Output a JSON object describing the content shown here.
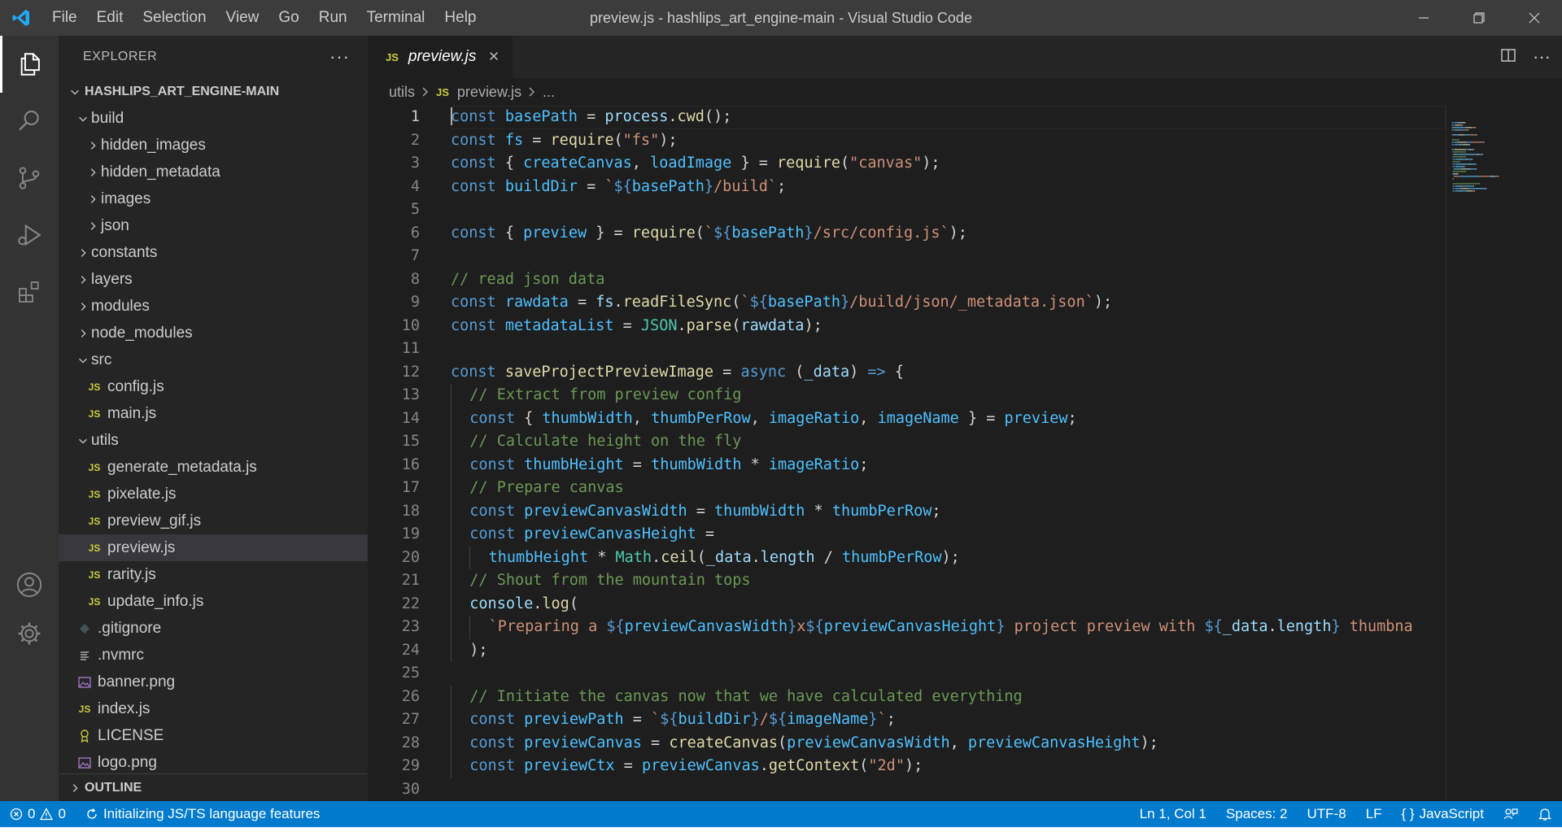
{
  "window": {
    "title": "preview.js - hashlips_art_engine-main - Visual Studio Code",
    "menu": [
      "File",
      "Edit",
      "Selection",
      "View",
      "Go",
      "Run",
      "Terminal",
      "Help"
    ]
  },
  "sidebar": {
    "header": "EXPLORER",
    "root": "HASHLIPS_ART_ENGINE-MAIN",
    "outline": "OUTLINE",
    "tree": [
      {
        "label": "build",
        "type": "folder",
        "open": true,
        "depth": 1
      },
      {
        "label": "hidden_images",
        "type": "folder",
        "open": false,
        "depth": 2
      },
      {
        "label": "hidden_metadata",
        "type": "folder",
        "open": false,
        "depth": 2
      },
      {
        "label": "images",
        "type": "folder",
        "open": false,
        "depth": 2
      },
      {
        "label": "json",
        "type": "folder",
        "open": false,
        "depth": 2
      },
      {
        "label": "constants",
        "type": "folder",
        "open": false,
        "depth": 1
      },
      {
        "label": "layers",
        "type": "folder",
        "open": false,
        "depth": 1
      },
      {
        "label": "modules",
        "type": "folder",
        "open": false,
        "depth": 1
      },
      {
        "label": "node_modules",
        "type": "folder",
        "open": false,
        "depth": 1
      },
      {
        "label": "src",
        "type": "folder",
        "open": true,
        "depth": 1
      },
      {
        "label": "config.js",
        "type": "js",
        "depth": 2
      },
      {
        "label": "main.js",
        "type": "js",
        "depth": 2
      },
      {
        "label": "utils",
        "type": "folder",
        "open": true,
        "depth": 1
      },
      {
        "label": "generate_metadata.js",
        "type": "js",
        "depth": 2
      },
      {
        "label": "pixelate.js",
        "type": "js",
        "depth": 2
      },
      {
        "label": "preview_gif.js",
        "type": "js",
        "depth": 2
      },
      {
        "label": "preview.js",
        "type": "js",
        "depth": 2,
        "selected": true
      },
      {
        "label": "rarity.js",
        "type": "js",
        "depth": 2
      },
      {
        "label": "update_info.js",
        "type": "js",
        "depth": 2
      },
      {
        "label": ".gitignore",
        "type": "git",
        "depth": 1
      },
      {
        "label": ".nvmrc",
        "type": "text",
        "depth": 1
      },
      {
        "label": "banner.png",
        "type": "image",
        "depth": 1
      },
      {
        "label": "index.js",
        "type": "js",
        "depth": 1
      },
      {
        "label": "LICENSE",
        "type": "license",
        "depth": 1
      },
      {
        "label": "logo.png",
        "type": "image",
        "depth": 1
      }
    ]
  },
  "editor": {
    "tab_label": "preview.js",
    "js_badge": "JS",
    "breadcrumb": [
      "utils",
      "preview.js",
      "..."
    ],
    "lines": [
      [
        [
          "kw",
          "const"
        ],
        [
          "p",
          " "
        ],
        [
          "cvar",
          "basePath"
        ],
        [
          "p",
          " = "
        ],
        [
          "var",
          "process"
        ],
        [
          "p",
          "."
        ],
        [
          "fn",
          "cwd"
        ],
        [
          "p",
          "();"
        ]
      ],
      [
        [
          "kw",
          "const"
        ],
        [
          "p",
          " "
        ],
        [
          "cvar",
          "fs"
        ],
        [
          "p",
          " = "
        ],
        [
          "fn",
          "require"
        ],
        [
          "p",
          "("
        ],
        [
          "str",
          "\"fs\""
        ],
        [
          "p",
          ");"
        ]
      ],
      [
        [
          "kw",
          "const"
        ],
        [
          "p",
          " { "
        ],
        [
          "cvar",
          "createCanvas"
        ],
        [
          "p",
          ", "
        ],
        [
          "cvar",
          "loadImage"
        ],
        [
          "p",
          " } = "
        ],
        [
          "fn",
          "require"
        ],
        [
          "p",
          "("
        ],
        [
          "str",
          "\"canvas\""
        ],
        [
          "p",
          ");"
        ]
      ],
      [
        [
          "kw",
          "const"
        ],
        [
          "p",
          " "
        ],
        [
          "cvar",
          "buildDir"
        ],
        [
          "p",
          " = "
        ],
        [
          "str",
          "`"
        ],
        [
          "tmpl",
          "${"
        ],
        [
          "cvar",
          "basePath"
        ],
        [
          "tmpl",
          "}"
        ],
        [
          "str",
          "/build`"
        ],
        [
          "p",
          ";"
        ]
      ],
      [],
      [
        [
          "kw",
          "const"
        ],
        [
          "p",
          " { "
        ],
        [
          "cvar",
          "preview"
        ],
        [
          "p",
          " } = "
        ],
        [
          "fn",
          "require"
        ],
        [
          "p",
          "("
        ],
        [
          "str",
          "`"
        ],
        [
          "tmpl",
          "${"
        ],
        [
          "cvar",
          "basePath"
        ],
        [
          "tmpl",
          "}"
        ],
        [
          "str",
          "/src/config.js`"
        ],
        [
          "p",
          ");"
        ]
      ],
      [],
      [
        [
          "cm",
          "// read json data"
        ]
      ],
      [
        [
          "kw",
          "const"
        ],
        [
          "p",
          " "
        ],
        [
          "cvar",
          "rawdata"
        ],
        [
          "p",
          " = "
        ],
        [
          "var",
          "fs"
        ],
        [
          "p",
          "."
        ],
        [
          "fn",
          "readFileSync"
        ],
        [
          "p",
          "("
        ],
        [
          "str",
          "`"
        ],
        [
          "tmpl",
          "${"
        ],
        [
          "cvar",
          "basePath"
        ],
        [
          "tmpl",
          "}"
        ],
        [
          "str",
          "/build/json/_metadata.json`"
        ],
        [
          "p",
          ");"
        ]
      ],
      [
        [
          "kw",
          "const"
        ],
        [
          "p",
          " "
        ],
        [
          "cvar",
          "metadataList"
        ],
        [
          "p",
          " = "
        ],
        [
          "ty",
          "JSON"
        ],
        [
          "p",
          "."
        ],
        [
          "fn",
          "parse"
        ],
        [
          "p",
          "("
        ],
        [
          "var",
          "rawdata"
        ],
        [
          "p",
          ");"
        ]
      ],
      [],
      [
        [
          "kw",
          "const"
        ],
        [
          "p",
          " "
        ],
        [
          "fn",
          "saveProjectPreviewImage"
        ],
        [
          "p",
          " = "
        ],
        [
          "kw",
          "async"
        ],
        [
          "p",
          " ("
        ],
        [
          "var",
          "_data"
        ],
        [
          "p",
          ") "
        ],
        [
          "kw",
          "=>"
        ],
        [
          "p",
          " {"
        ]
      ],
      [
        [
          "g",
          ""
        ],
        [
          "cm",
          "// Extract from preview config"
        ]
      ],
      [
        [
          "g",
          ""
        ],
        [
          "kw",
          "const"
        ],
        [
          "p",
          " { "
        ],
        [
          "cvar",
          "thumbWidth"
        ],
        [
          "p",
          ", "
        ],
        [
          "cvar",
          "thumbPerRow"
        ],
        [
          "p",
          ", "
        ],
        [
          "cvar",
          "imageRatio"
        ],
        [
          "p",
          ", "
        ],
        [
          "cvar",
          "imageName"
        ],
        [
          "p",
          " } = "
        ],
        [
          "cvar",
          "preview"
        ],
        [
          "p",
          ";"
        ]
      ],
      [
        [
          "g",
          ""
        ],
        [
          "cm",
          "// Calculate height on the fly"
        ]
      ],
      [
        [
          "g",
          ""
        ],
        [
          "kw",
          "const"
        ],
        [
          "p",
          " "
        ],
        [
          "cvar",
          "thumbHeight"
        ],
        [
          "p",
          " = "
        ],
        [
          "cvar",
          "thumbWidth"
        ],
        [
          "p",
          " * "
        ],
        [
          "cvar",
          "imageRatio"
        ],
        [
          "p",
          ";"
        ]
      ],
      [
        [
          "g",
          ""
        ],
        [
          "cm",
          "// Prepare canvas"
        ]
      ],
      [
        [
          "g",
          ""
        ],
        [
          "kw",
          "const"
        ],
        [
          "p",
          " "
        ],
        [
          "cvar",
          "previewCanvasWidth"
        ],
        [
          "p",
          " = "
        ],
        [
          "cvar",
          "thumbWidth"
        ],
        [
          "p",
          " * "
        ],
        [
          "cvar",
          "thumbPerRow"
        ],
        [
          "p",
          ";"
        ]
      ],
      [
        [
          "g",
          ""
        ],
        [
          "kw",
          "const"
        ],
        [
          "p",
          " "
        ],
        [
          "cvar",
          "previewCanvasHeight"
        ],
        [
          "p",
          " ="
        ]
      ],
      [
        [
          "g",
          ""
        ],
        [
          "g",
          ""
        ],
        [
          "cvar",
          "thumbHeight"
        ],
        [
          "p",
          " * "
        ],
        [
          "ty",
          "Math"
        ],
        [
          "p",
          "."
        ],
        [
          "fn",
          "ceil"
        ],
        [
          "p",
          "("
        ],
        [
          "var",
          "_data"
        ],
        [
          "p",
          "."
        ],
        [
          "var",
          "length"
        ],
        [
          "p",
          " / "
        ],
        [
          "cvar",
          "thumbPerRow"
        ],
        [
          "p",
          ");"
        ]
      ],
      [
        [
          "g",
          ""
        ],
        [
          "cm",
          "// Shout from the mountain tops"
        ]
      ],
      [
        [
          "g",
          ""
        ],
        [
          "var",
          "console"
        ],
        [
          "p",
          "."
        ],
        [
          "fn",
          "log"
        ],
        [
          "p",
          "("
        ]
      ],
      [
        [
          "g",
          ""
        ],
        [
          "g",
          ""
        ],
        [
          "str",
          "`Preparing a "
        ],
        [
          "tmpl",
          "${"
        ],
        [
          "cvar",
          "previewCanvasWidth"
        ],
        [
          "tmpl",
          "}"
        ],
        [
          "str",
          "x"
        ],
        [
          "tmpl",
          "${"
        ],
        [
          "cvar",
          "previewCanvasHeight"
        ],
        [
          "tmpl",
          "}"
        ],
        [
          "str",
          " project preview with "
        ],
        [
          "tmpl",
          "${"
        ],
        [
          "var",
          "_data"
        ],
        [
          "p",
          "."
        ],
        [
          "var",
          "length"
        ],
        [
          "tmpl",
          "}"
        ],
        [
          "str",
          " thumbna"
        ]
      ],
      [
        [
          "g",
          ""
        ],
        [
          "p",
          ");"
        ]
      ],
      [],
      [
        [
          "g",
          ""
        ],
        [
          "cm",
          "// Initiate the canvas now that we have calculated everything"
        ]
      ],
      [
        [
          "g",
          ""
        ],
        [
          "kw",
          "const"
        ],
        [
          "p",
          " "
        ],
        [
          "cvar",
          "previewPath"
        ],
        [
          "p",
          " = "
        ],
        [
          "str",
          "`"
        ],
        [
          "tmpl",
          "${"
        ],
        [
          "cvar",
          "buildDir"
        ],
        [
          "tmpl",
          "}"
        ],
        [
          "str",
          "/"
        ],
        [
          "tmpl",
          "${"
        ],
        [
          "cvar",
          "imageName"
        ],
        [
          "tmpl",
          "}"
        ],
        [
          "str",
          "`"
        ],
        [
          "p",
          ";"
        ]
      ],
      [
        [
          "g",
          ""
        ],
        [
          "kw",
          "const"
        ],
        [
          "p",
          " "
        ],
        [
          "cvar",
          "previewCanvas"
        ],
        [
          "p",
          " = "
        ],
        [
          "fn",
          "createCanvas"
        ],
        [
          "p",
          "("
        ],
        [
          "cvar",
          "previewCanvasWidth"
        ],
        [
          "p",
          ", "
        ],
        [
          "cvar",
          "previewCanvasHeight"
        ],
        [
          "p",
          ");"
        ]
      ],
      [
        [
          "g",
          ""
        ],
        [
          "kw",
          "const"
        ],
        [
          "p",
          " "
        ],
        [
          "cvar",
          "previewCtx"
        ],
        [
          "p",
          " = "
        ],
        [
          "cvar",
          "previewCanvas"
        ],
        [
          "p",
          "."
        ],
        [
          "fn",
          "getContext"
        ],
        [
          "p",
          "("
        ],
        [
          "str",
          "\"2d\""
        ],
        [
          "p",
          ");"
        ]
      ],
      []
    ]
  },
  "statusbar": {
    "errors": "0",
    "warnings": "0",
    "task": "Initializing JS/TS language features",
    "position": "Ln 1, Col 1",
    "spaces": "Spaces: 2",
    "encoding": "UTF-8",
    "eol": "LF",
    "language": "JavaScript"
  },
  "colors": {
    "accent": "#007acc",
    "js_badge": "#cbcb41"
  }
}
